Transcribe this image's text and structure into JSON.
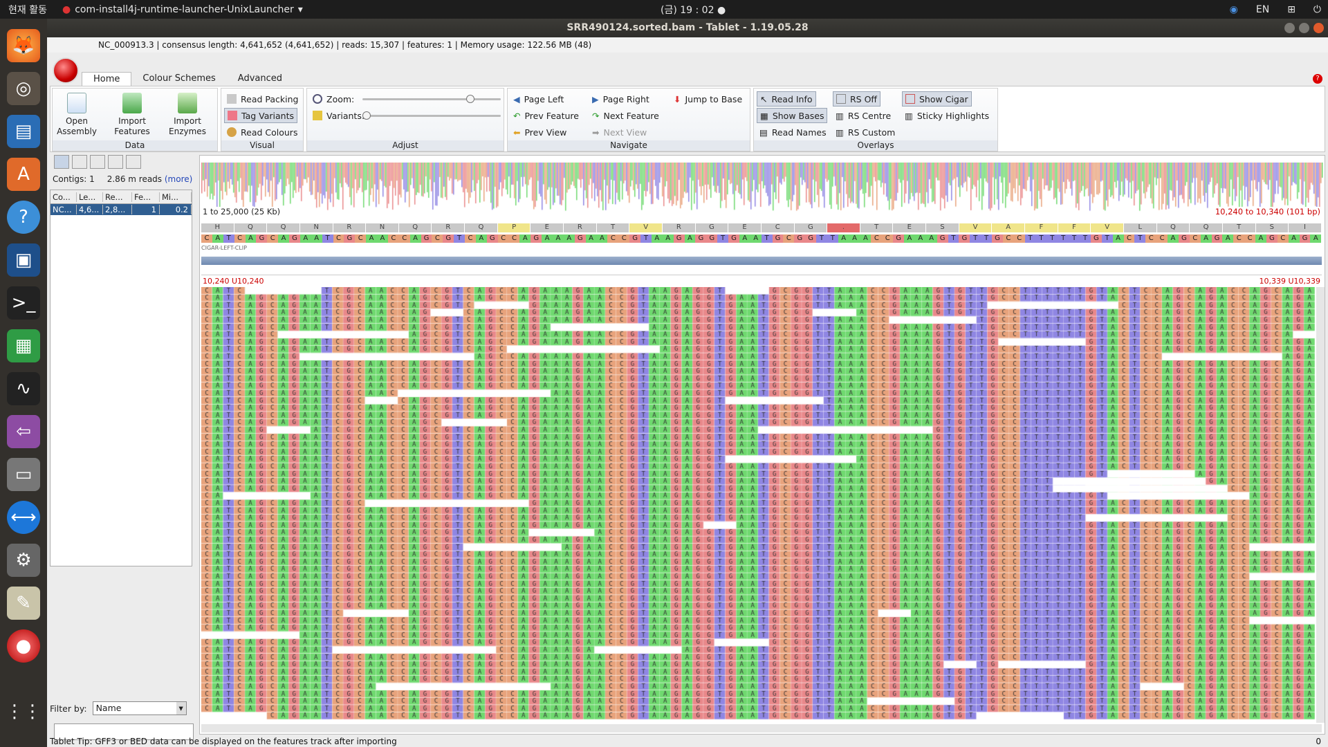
{
  "topbar": {
    "activities": "현재 활동",
    "app_name": "com-install4j-runtime-launcher-UnixLauncher",
    "clock": "(금) 19 : 02 ●",
    "lang": "EN"
  },
  "window": {
    "title": "SRR490124.sorted.bam - Tablet - 1.19.05.28"
  },
  "infobar": {
    "text": "NC_000913.3  |  consensus length: 4,641,652 (4,641,652)  |  reads: 15,307  |  features: 1  |  Memory usage: 122.56 MB (48)"
  },
  "tabs": [
    "Home",
    "Colour Schemes",
    "Advanced"
  ],
  "ribbon": {
    "data": {
      "label": "Data",
      "open": "Open Assembly",
      "import_features": "Import Features",
      "import_enzymes": "Import Enzymes"
    },
    "visual": {
      "label": "Visual",
      "read_packing": "Read Packing",
      "tag_variants": "Tag Variants",
      "read_colours": "Read Colours"
    },
    "adjust": {
      "label": "Adjust",
      "zoom": "Zoom:",
      "variants": "Variants:",
      "zoom_level": 0.8,
      "variants_level": 0.0
    },
    "navigate": {
      "label": "Navigate",
      "page_left": "Page Left",
      "page_right": "Page Right",
      "jump": "Jump to Base",
      "prev_feature": "Prev Feature",
      "next_feature": "Next Feature",
      "prev_view": "Prev View",
      "next_view": "Next View"
    },
    "overlays": {
      "label": "Overlays",
      "read_info": "Read Info",
      "rs_off": "RS Off",
      "show_cigar": "Show Cigar",
      "show_bases": "Show Bases",
      "rs_centre": "RS Centre",
      "sticky": "Sticky Highlights",
      "read_names": "Read Names",
      "rs_custom": "RS Custom"
    }
  },
  "left": {
    "contigs": "Contigs: 1",
    "reads": "2.86 m reads",
    "more": "(more)",
    "columns": [
      "Co...",
      "Le...",
      "Re...",
      "Fe...",
      "Mi..."
    ],
    "row": [
      "NC...",
      "4,6...",
      "2,8...",
      "1",
      "0.2"
    ],
    "filter_label": "Filter by:",
    "filter_value": "Name"
  },
  "viewer": {
    "overview_left": "1 to 25,000 (25 Kb)",
    "overview_right": "10,240 to 10,340 (101 bp)",
    "translation": [
      "H",
      "Q",
      "Q",
      "N",
      "R",
      "N",
      "Q",
      "R",
      "Q",
      "P",
      "E",
      "R",
      "T",
      "V",
      "R",
      "G",
      "E",
      "C",
      "G",
      ".",
      "T",
      "E",
      "S",
      "V",
      "A",
      "F",
      "F",
      "V",
      "L",
      "Q",
      "Q",
      "T",
      "S",
      "I"
    ],
    "consensus": "CATCAGCAGAATCGCAACCAGCGTCAGCCAGAAAGAACCGTAAGAGGTGAATGCGGTTAAACCGAAAGTGTTGCCTTTTTTGTACTCCAGCAGACCAGCAGA",
    "cigar_label": "CIGAR-LEFT-CLIP",
    "pos_left": "10,240 U10,240",
    "pos_right": "10,339 U10,339"
  },
  "colors": {
    "A": "#6fd96f",
    "C": "#e8a37c",
    "G": "#e9888a",
    "T": "#8f86e3"
  },
  "status": {
    "tip": "Tablet Tip:  GFF3 or BED data can be displayed on the features track after importing",
    "right": "0"
  }
}
